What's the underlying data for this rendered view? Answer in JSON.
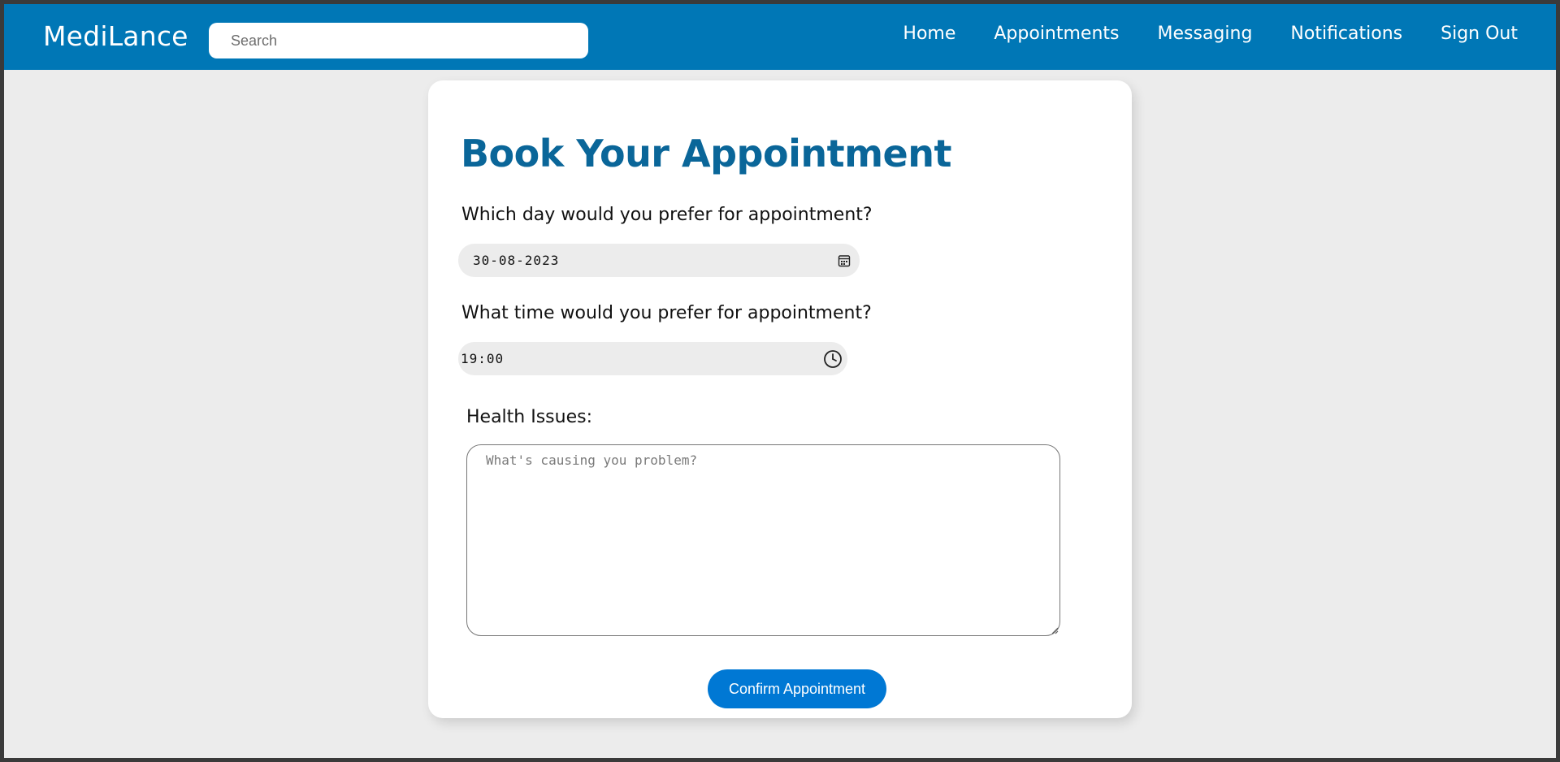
{
  "app": {
    "brand": "MediLance"
  },
  "header": {
    "search_placeholder": "Search",
    "nav": [
      {
        "label": "Home"
      },
      {
        "label": "Appointments"
      },
      {
        "label": "Messaging"
      },
      {
        "label": "Notifications"
      },
      {
        "label": "Sign Out"
      }
    ]
  },
  "form": {
    "title": "Book Your Appointment",
    "date_question": "Which day would you prefer for appointment?",
    "date_value": "30-08-2023",
    "time_question": "What time would you prefer for appointment?",
    "time_value": "19:00",
    "health_label": "Health Issues:",
    "health_placeholder": "What's causing you problem?",
    "confirm_label": "Confirm Appointment"
  },
  "colors": {
    "navbar": "#0077b6",
    "title": "#0a6699",
    "button": "#0078d4",
    "page_bg": "#ececec"
  },
  "icons": {
    "date": "calendar-icon",
    "time": "clock-icon"
  }
}
